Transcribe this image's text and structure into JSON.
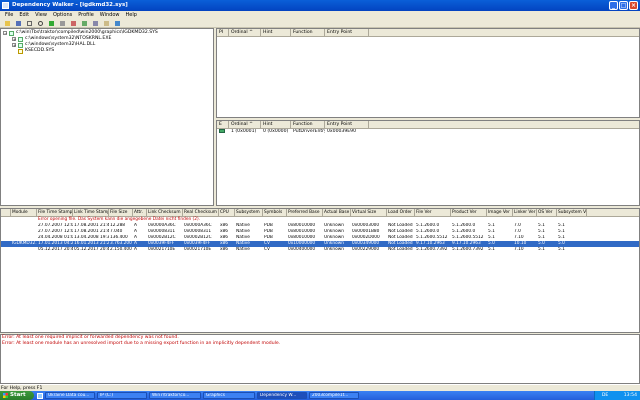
{
  "window": {
    "title": "Dependency Walker - [igdkmd32.sys]"
  },
  "menu": [
    "File",
    "Edit",
    "View",
    "Options",
    "Profile",
    "Window",
    "Help"
  ],
  "tree": {
    "root": "c:\\win\\Tbs\\traktor\\compiled\\win2000\\graphics\\IGDKMD32.SYS",
    "children": [
      "c:\\windows\\system32\\NTOSKRNL.EXE",
      "c:\\windows\\system32\\HAL.DLL",
      "KSECDD.SYS"
    ]
  },
  "parent_imports": {
    "columns": [
      "PI",
      "Ordinal ^",
      "Hint",
      "Function",
      "Entry Point"
    ],
    "rows": []
  },
  "exports": {
    "columns": [
      "E",
      "Ordinal ^",
      "Hint",
      "Function",
      "Entry Point"
    ],
    "rows": [
      [
        "",
        "1 (0x0001)",
        "0 (0x0000)",
        "PutDriverEntry",
        "0x00039E90"
      ]
    ]
  },
  "modules": {
    "columns": [
      "",
      "Module",
      "File Time Stamp",
      "Link Time Stamp",
      "File Size",
      "Attr.",
      "Link Checksum",
      "Real Checksum",
      "CPU",
      "Subsystem",
      "Symbols",
      "Preferred Base",
      "Actual Base",
      "Virtual Size",
      "Load Order",
      "File Ver",
      "Product Ver",
      "Image Ver",
      "Linker Ver",
      "OS Ver",
      "Subsystem Ver"
    ],
    "rows": [
      [
        "",
        "",
        "Error opening file. Das System kann die angegebene Datei nicht finden (2).",
        "",
        "",
        "",
        "",
        "",
        "",
        "",
        "",
        "",
        "",
        "",
        "",
        "",
        "",
        "",
        "",
        "",
        ""
      ],
      [
        "",
        "",
        "27.07.2007 12:00",
        "17.08.2001 21:49",
        "12.288",
        "A",
        "0x0000A36C",
        "0x0000A36C",
        "x86",
        "Native",
        "PDB",
        "0x80010000",
        "Unknown",
        "0x00003000",
        "Not Loaded",
        "5.1.2600.0",
        "5.1.2600.0",
        "5.1",
        "7.0",
        "5.1",
        "5.1"
      ],
      [
        "",
        "",
        "27.07.2007 12:00",
        "17.08.2001 21:49",
        "7.040",
        "A",
        "0x00008311",
        "0x00008311",
        "x86",
        "Native",
        "PDB",
        "0x80010000",
        "Unknown",
        "0x00001B80",
        "Not Loaded",
        "5.1.2600.0",
        "5.1.2600.0",
        "5.1",
        "7.0",
        "5.1",
        "5.1"
      ],
      [
        "",
        "",
        "24.04.2008 01:01",
        "13.04.2008 19:31",
        "136.400",
        "A",
        "0x0002B12C",
        "0x0002B12C",
        "x86",
        "Native",
        "PDB",
        "0x80010000",
        "Unknown",
        "0x0002D000",
        "Not Loaded",
        "5.1.2600.5512",
        "5.1.2600.5512",
        "5.1",
        "7.10",
        "5.1",
        "5.1"
      ],
      [
        "",
        "IGDKMD32.SYS",
        "17.01.2013 04:29",
        "16.01.2013 21:29",
        "3.763.200",
        "A",
        "0x0039F4FF",
        "0x0039F4FF",
        "x86",
        "Native",
        "CV",
        "0x10000000",
        "Unknown",
        "0x00349000",
        "Not Loaded",
        "9.17.10.2963",
        "9.17.10.2963",
        "5.0",
        "10.10",
        "5.0",
        "5.0"
      ],
      [
        "",
        "",
        "05.12.2017 20:45",
        "05.12.2017 20:45",
        "2.150.400",
        "A",
        "0x0021710E",
        "0x0021710E",
        "x86",
        "Native",
        "CV",
        "0x00400000",
        "Unknown",
        "0x00229000",
        "Not Loaded",
        "5.1.2600.7392",
        "5.1.2600.7392",
        "5.1",
        "7.10",
        "5.1",
        "5.1"
      ]
    ]
  },
  "log": [
    "Error: At least one required implicit or forwarded dependency was not found.",
    "Error: At least one module has an unresolved import due to a missing export function in an implicitly dependent module."
  ],
  "status": "For Help, press F1",
  "taskbar": {
    "start": "Start",
    "tasks": [
      "Ukraine Data cou...",
      "IP (C:)",
      "Win7\\traktor\\co...",
      "Graphics",
      "Dependency W...",
      "2003compile1t..."
    ],
    "tray_lang": "DE",
    "clock": "13:54"
  },
  "colors": {
    "title": "#0a5fd8",
    "selection": "#316ac5",
    "error": "#c00000"
  }
}
